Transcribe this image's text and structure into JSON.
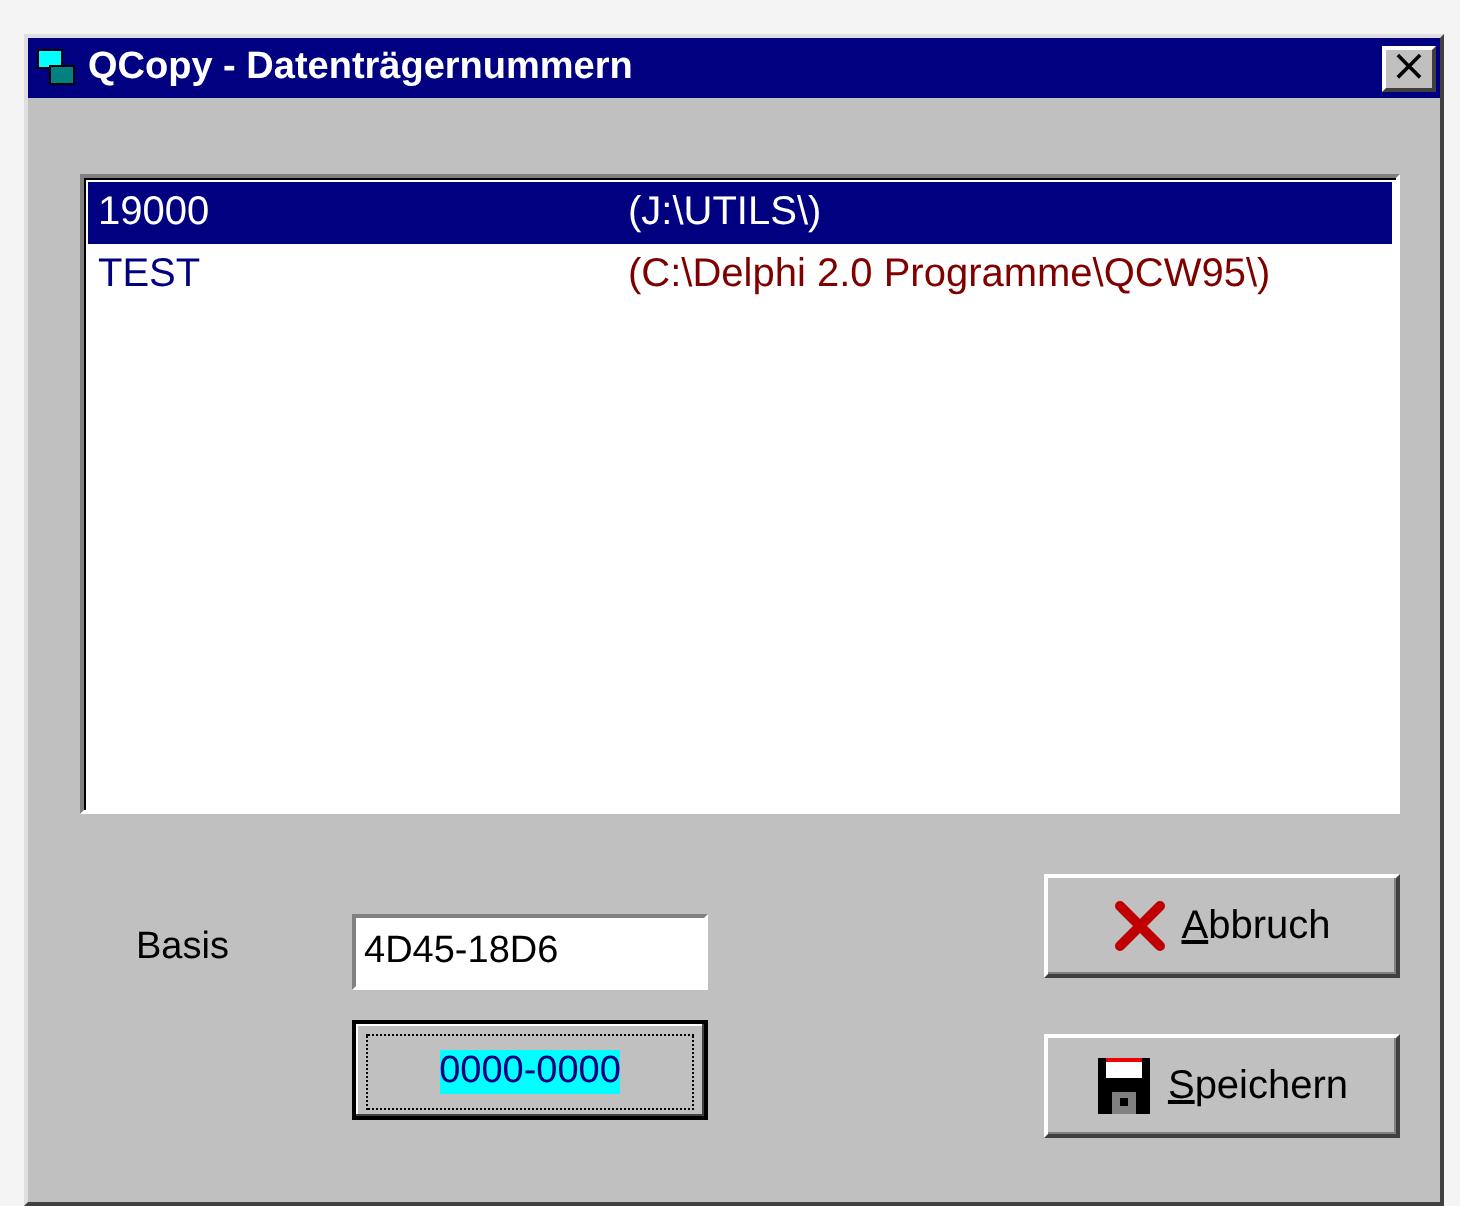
{
  "window": {
    "title": "QCopy - Datenträgernummern",
    "close": "×"
  },
  "list": [
    {
      "number": "19000",
      "path": "(J:\\UTILS\\)",
      "selected": true
    },
    {
      "number": "TEST",
      "path": "(C:\\Delphi 2.0 Programme\\QCW95\\)",
      "selected": false
    }
  ],
  "basis": {
    "label": "Basis",
    "value": "4D45-18D6"
  },
  "result_button": {
    "label": "0000-0000",
    "focused": true
  },
  "buttons": [
    {
      "kind": "cancel",
      "mnemonic": "A",
      "label": "bbruch"
    },
    {
      "kind": "save",
      "mnemonic": "S",
      "label": "peichern"
    }
  ]
}
